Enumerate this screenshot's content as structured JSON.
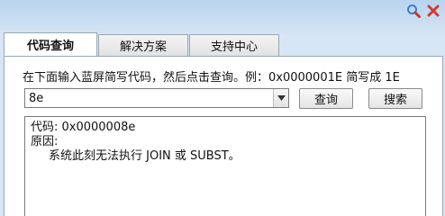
{
  "titlebar": {
    "icons": [
      "search-icon",
      "close-icon"
    ],
    "colors": {
      "search": "#3b7bd5",
      "close": "#d03b2f"
    }
  },
  "tabs": [
    {
      "label": "代码查询",
      "active": true
    },
    {
      "label": "解决方案",
      "active": false
    },
    {
      "label": "支持中心",
      "active": false
    }
  ],
  "main": {
    "hint": "在下面输入蓝屏简写代码，然后点击查询。例：0x0000001E 简写成 1E",
    "code_input": {
      "value": "8e"
    },
    "query_button": "查询",
    "search_button": "搜索",
    "result": {
      "code_line": "代码: 0x0000008e",
      "reason_label": "原因:",
      "reason_text": "系统此刻无法执行 JOIN 或 SUBST。"
    }
  }
}
